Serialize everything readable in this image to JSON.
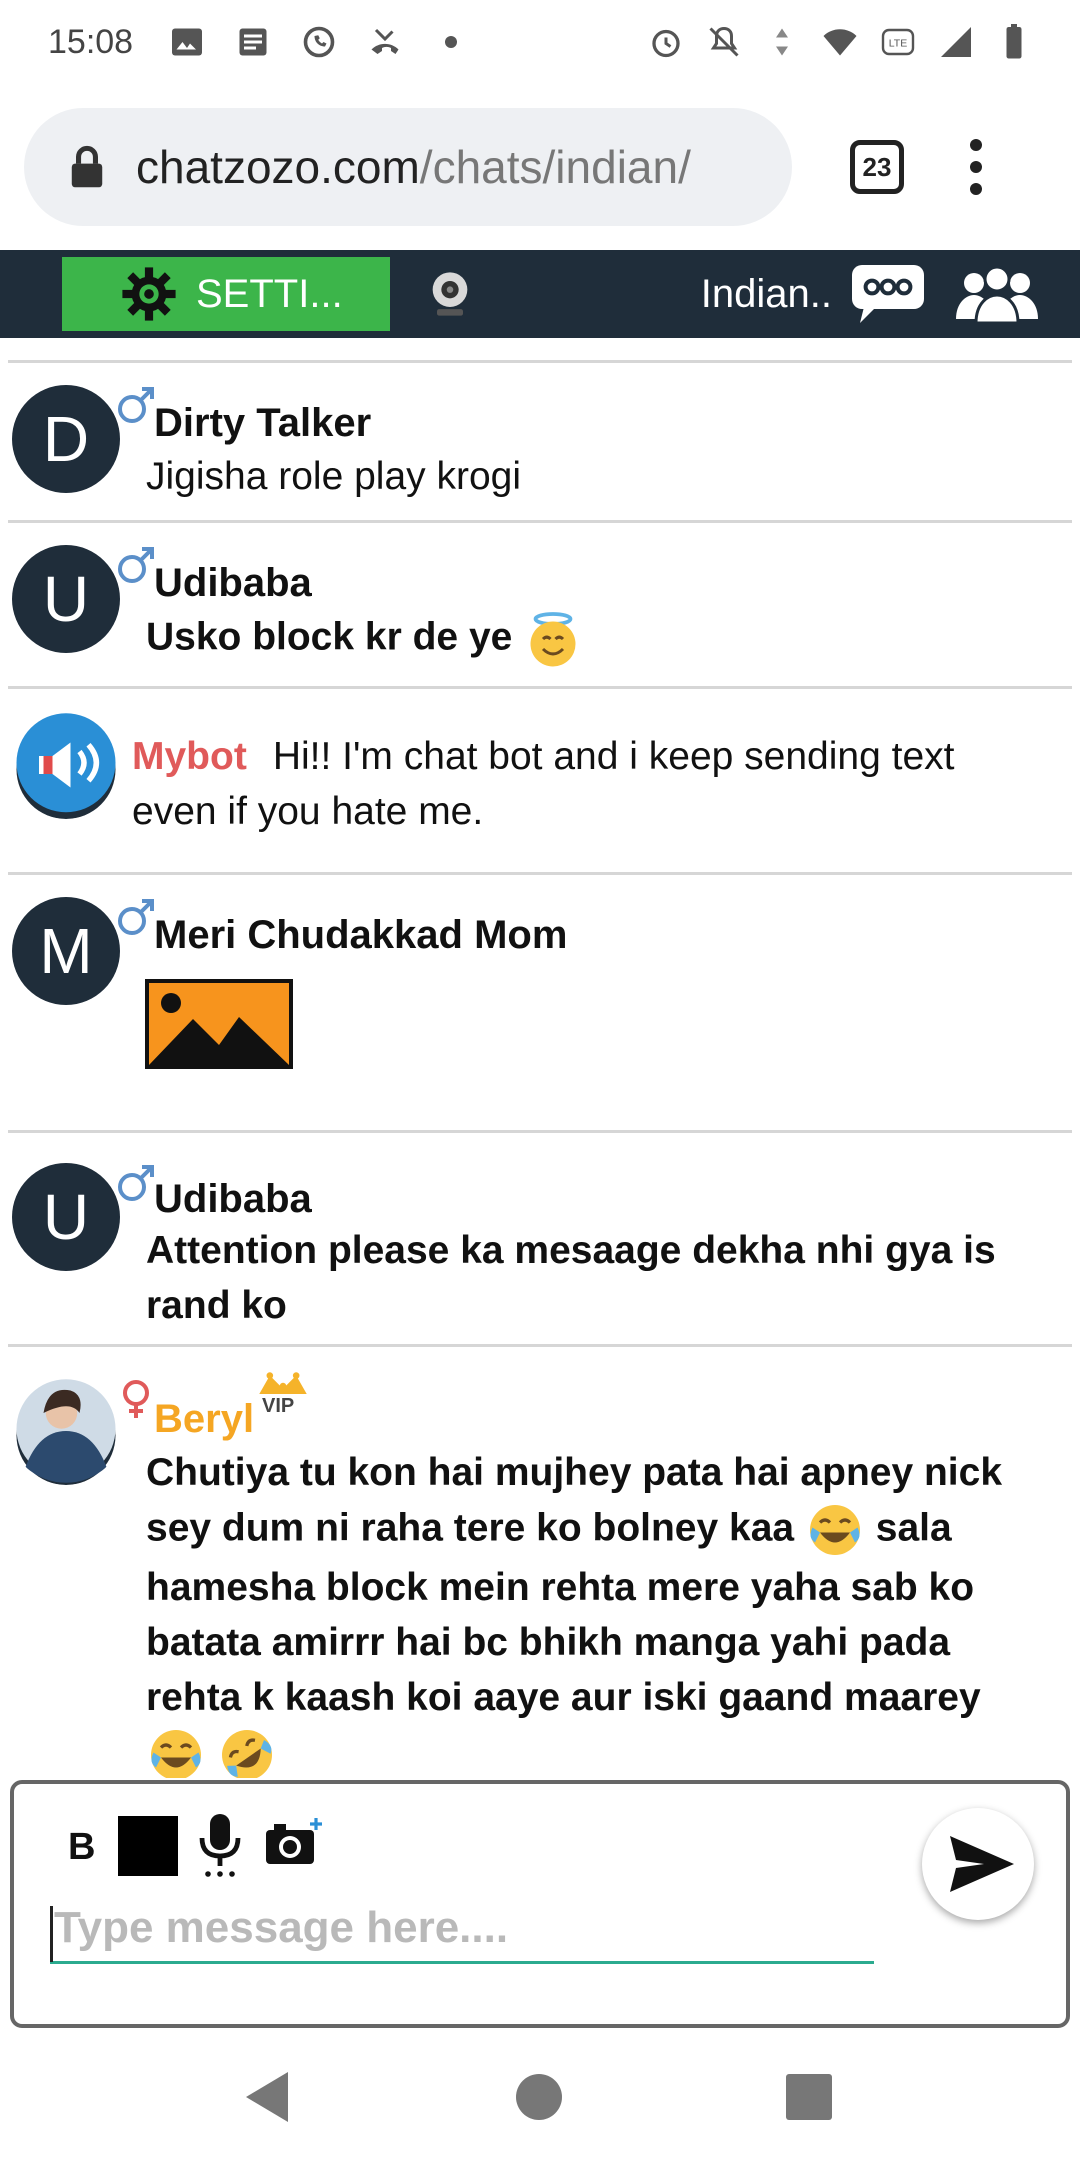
{
  "status_bar": {
    "time": "15:08"
  },
  "browser": {
    "url_domain": "chatzozo.com",
    "url_path": "/chats/indian/",
    "tab_count": "23"
  },
  "header": {
    "settings_label": "SETTI...",
    "room_name": "Indian..",
    "colors": {
      "background": "#1f2d3a",
      "settings_button": "#3cb54a"
    }
  },
  "messages": [
    {
      "user": "Dirty Talker",
      "avatar_letter": "D",
      "gender": "male",
      "text": "Jigisha role play krogi",
      "bold": false
    },
    {
      "user": "Udibaba",
      "avatar_letter": "U",
      "gender": "male",
      "text": "Usko block kr de ye",
      "bold": true,
      "emojis": [
        "smiling-face-with-halo"
      ]
    },
    {
      "user": "Mybot",
      "avatar": "speaker-icon",
      "text": "Hi!! I'm chat bot and i keep sending text even if you hate me.",
      "name_color": "#e05a5a"
    },
    {
      "user": "Meri Chudakkad Mom",
      "avatar_letter": "M",
      "gender": "male",
      "attachment": "image-placeholder"
    },
    {
      "user": "Udibaba",
      "avatar_letter": "U",
      "gender": "male",
      "text": "Attention please ka mesaage dekha nhi gya is rand ko",
      "bold": true
    },
    {
      "user": "Beryl",
      "avatar": "photo-avatar",
      "gender": "female",
      "badge": "VIP",
      "name_color": "#f5a623",
      "text_part1": "Chutiya tu kon hai mujhey pata hai apney nick sey dum ni raha tere ko bolney kaa",
      "text_part2": "sala hamesha block mein rehta mere yaha sab ko batata amirrr hai bc bhikh manga yahi pada rehta k kaash koi aaye aur iski gaand maarey",
      "emojis": [
        "face-with-tears-of-joy",
        "face-with-tears-of-joy",
        "rolling-on-floor-laughing"
      ]
    }
  ],
  "composer": {
    "bold_label": "B",
    "placeholder": "Type message here....",
    "accent_color": "#2bab8f"
  }
}
